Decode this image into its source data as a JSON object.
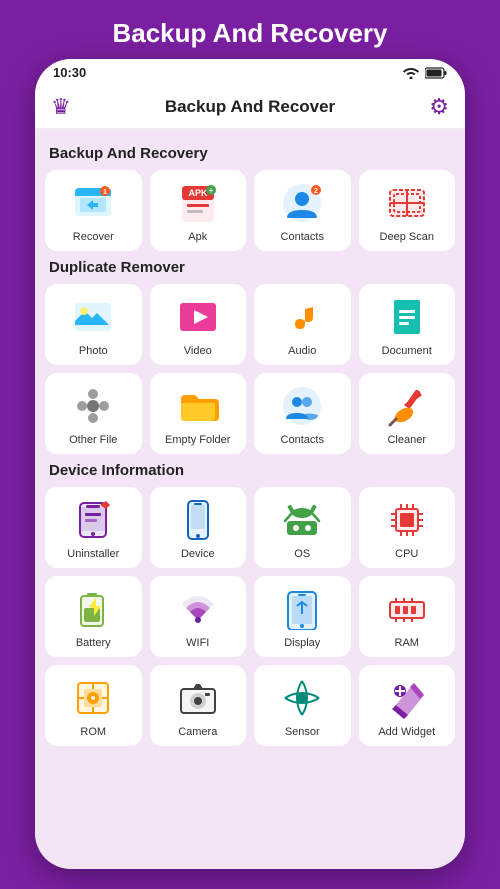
{
  "page": {
    "title": "Backup And Recovery",
    "status_time": "10:30"
  },
  "topbar": {
    "title": "Backup And Recover"
  },
  "sections": [
    {
      "id": "backup",
      "label": "Backup And Recovery",
      "items": [
        {
          "id": "recover",
          "label": "Recover"
        },
        {
          "id": "apk",
          "label": "Apk"
        },
        {
          "id": "contacts",
          "label": "Contacts"
        },
        {
          "id": "deepscan",
          "label": "Deep Scan"
        }
      ]
    },
    {
      "id": "duplicate",
      "label": "Duplicate Remover",
      "items": [
        {
          "id": "photo",
          "label": "Photo"
        },
        {
          "id": "video",
          "label": "Video"
        },
        {
          "id": "audio",
          "label": "Audio"
        },
        {
          "id": "document",
          "label": "Document"
        },
        {
          "id": "otherfile",
          "label": "Other File"
        },
        {
          "id": "emptyfolder",
          "label": "Empty Folder"
        },
        {
          "id": "contacts2",
          "label": "Contacts"
        },
        {
          "id": "cleaner",
          "label": "Cleaner"
        }
      ]
    },
    {
      "id": "device",
      "label": "Device Information",
      "items": [
        {
          "id": "uninstaller",
          "label": "Uninstaller"
        },
        {
          "id": "device",
          "label": "Device"
        },
        {
          "id": "os",
          "label": "OS"
        },
        {
          "id": "cpu",
          "label": "CPU"
        },
        {
          "id": "battery",
          "label": "Battery"
        },
        {
          "id": "wifi",
          "label": "WIFI"
        },
        {
          "id": "display",
          "label": "Display"
        },
        {
          "id": "ram",
          "label": "RAM"
        },
        {
          "id": "rom",
          "label": "ROM"
        },
        {
          "id": "camera",
          "label": "Camera"
        },
        {
          "id": "sensor",
          "label": "Sensor"
        },
        {
          "id": "addwidget",
          "label": "Add Widget"
        }
      ]
    }
  ]
}
